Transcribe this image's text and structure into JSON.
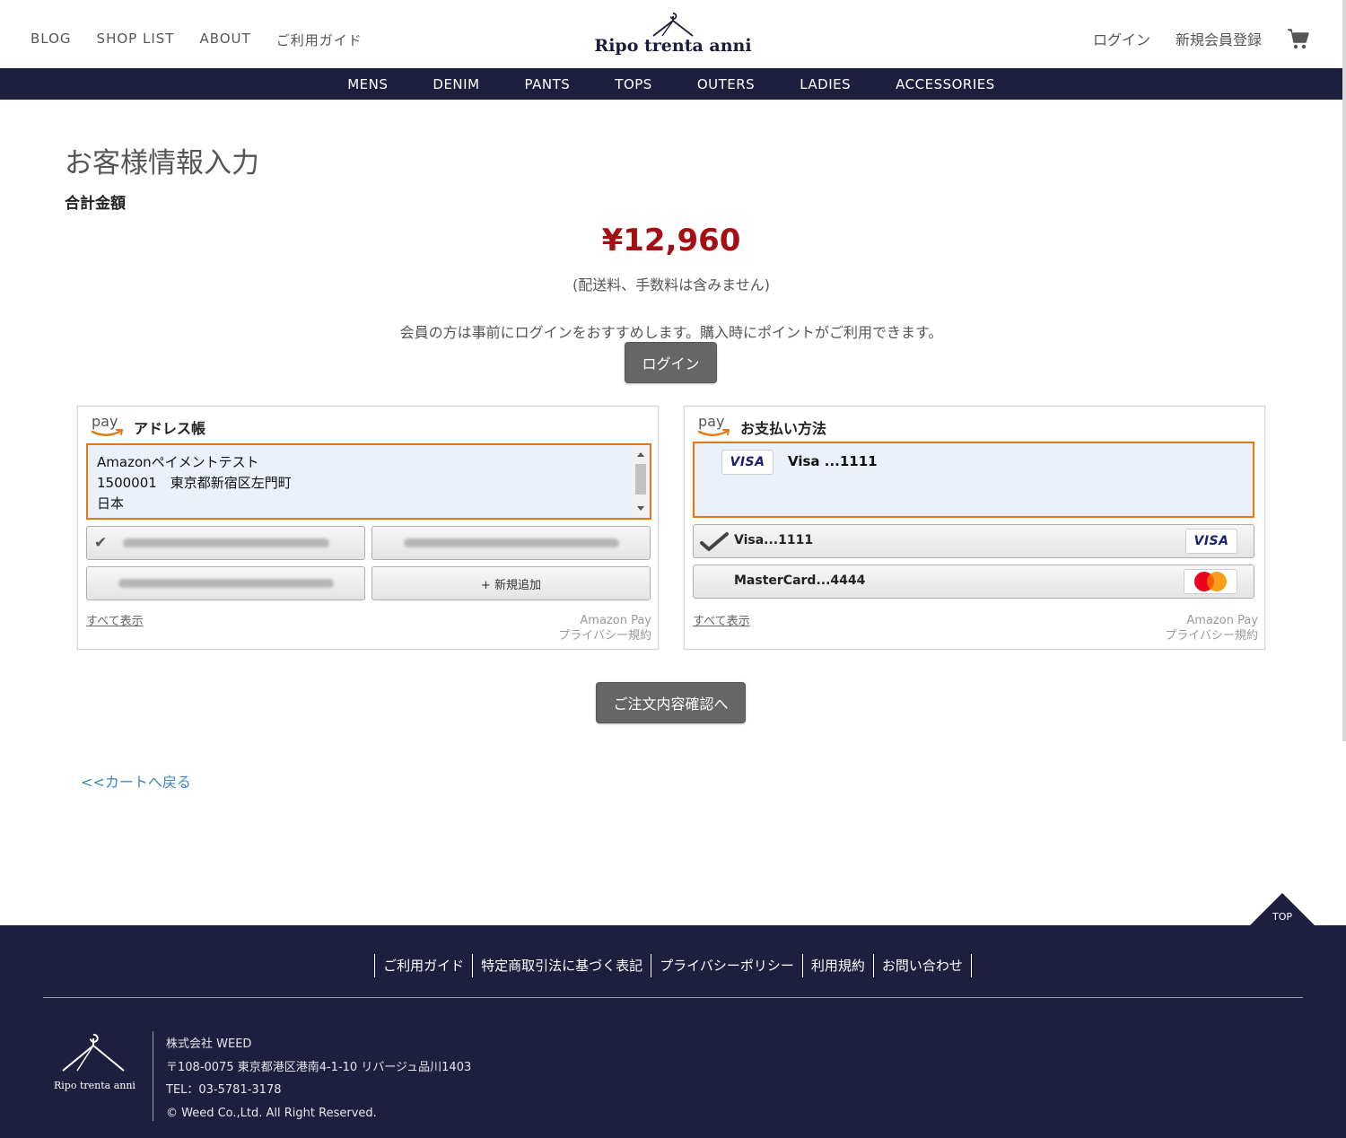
{
  "header": {
    "top_nav": [
      "BLOG",
      "SHOP LIST",
      "ABOUT",
      "ご利用ガイド"
    ],
    "logo_text": "Ripo trenta anni",
    "login": "ログイン",
    "register": "新規会員登録",
    "cart_icon": "cart-icon"
  },
  "categories": [
    "MENS",
    "DENIM",
    "PANTS",
    "TOPS",
    "OUTERS",
    "LADIES",
    "ACCESSORIES"
  ],
  "main": {
    "title": "お客様情報入力",
    "total_label": "合計金額",
    "total_amount": "¥12,960",
    "total_note": "(配送料、手数料は含みません)",
    "login_note": "会員の方は事前にログインをおすすめします。購入時にポイントがご利用できます。",
    "login_button": "ログイン",
    "confirm_button": "ご注文内容確認へ",
    "back_link": "<<カートへ戻る"
  },
  "address_widget": {
    "title": "アドレス帳",
    "selected_lines": [
      "Amazonペイメントテスト",
      "1500001　東京都新宿区左門町",
      "日本"
    ],
    "add_new": "+ 新規追加",
    "show_all": "すべて表示",
    "brand": "Amazon Pay",
    "privacy": "プライバシー規約"
  },
  "payment_widget": {
    "title": "お支払い方法",
    "selected": "Visa ...1111",
    "options": [
      "Visa...1111",
      "MasterCard...4444"
    ],
    "visa_brand": "VISA",
    "show_all": "すべて表示",
    "brand": "Amazon Pay",
    "privacy": "プライバシー規約"
  },
  "footer": {
    "top_label": "TOP",
    "links": [
      "ご利用ガイド",
      "特定商取引法に基づく表記",
      "プライバシーポリシー",
      "利用規約",
      "お問い合わせ"
    ],
    "logo_text": "Ripo trenta anni",
    "company": "株式会社 WEED",
    "address": "〒108-0075 東京都港区港南4-1-10 リバージュ品川1403",
    "tel": "TEL：03-5781-3178",
    "copyright": "© Weed Co.,Ltd. All Right Reserved."
  },
  "colors": {
    "nav_bg": "#1e1f3f",
    "price": "#a40f14",
    "amazon_orange": "#e47911",
    "selection_bg": "#eaf1fb",
    "link": "#3a86c8"
  }
}
